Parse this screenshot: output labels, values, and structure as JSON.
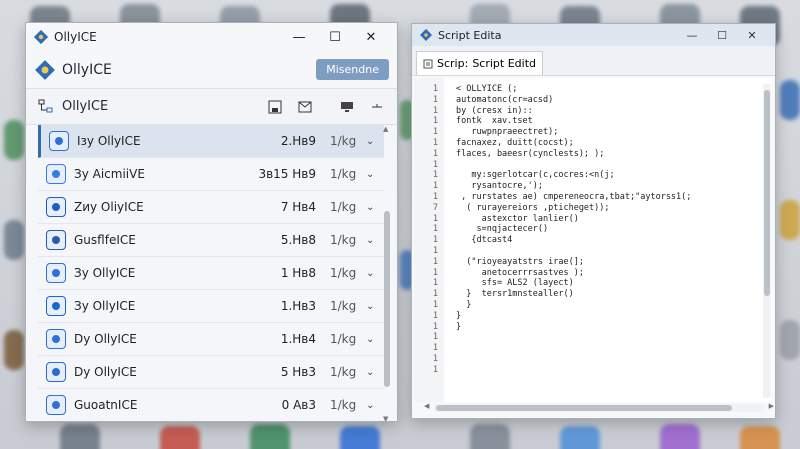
{
  "olly_window": {
    "title": "OllyICE",
    "controls": {
      "minimize": "—",
      "maximize": "☐",
      "close": "✕"
    },
    "app_name": "OllyICE",
    "primary_button": "Misendne",
    "toolbar_label": "OllyICE",
    "rows": [
      {
        "name": "Ізу OllyICE",
        "size": "2.Hв9",
        "rate": "1/kg",
        "icon_color": "#2f6fd6",
        "selected": true
      },
      {
        "name": "Зу AicmiiVE",
        "size": "3в15 Hв9",
        "rate": "1/kg",
        "icon_color": "#3a7be0",
        "selected": false
      },
      {
        "name": "Zиу OlіyICE",
        "size": "7 Hв4",
        "rate": "1/kg",
        "icon_color": "#1f5fbf",
        "selected": false
      },
      {
        "name": "GusflfeICE",
        "size": "5.Hв8",
        "rate": "1/kg",
        "icon_color": "#2a5aa8",
        "selected": false
      },
      {
        "name": "Зу OllyICE",
        "size": "1 Hв8",
        "rate": "1/kg",
        "icon_color": "#2f6fd6",
        "selected": false
      },
      {
        "name": "Зу OllyICE",
        "size": "1.Hв3",
        "rate": "1/kg",
        "icon_color": "#1d67c4",
        "selected": false
      },
      {
        "name": "Dy OllyICE",
        "size": "1.Hв4",
        "rate": "1/kg",
        "icon_color": "#2f6fd6",
        "selected": false
      },
      {
        "name": "Dy OllyICE",
        "size": "5 Hв3",
        "rate": "1/kg",
        "icon_color": "#2a6ad0",
        "selected": false
      },
      {
        "name": "GuoatnICE",
        "size": "0 Aв3",
        "rate": "1/kg",
        "icon_color": "#2f6fd6",
        "selected": false
      }
    ]
  },
  "editor_window": {
    "title": "Script Edita",
    "controls": {
      "minimize": "—",
      "maximize": "☐",
      "close": "✕"
    },
    "tab_prefix": "Scrip:",
    "tab_label": "Script Editd",
    "line_numbers": [
      "1",
      "1",
      "1",
      "1",
      "1",
      "1",
      "1",
      "1",
      "1",
      "1",
      "1",
      "7",
      "1",
      "1",
      "1",
      "1",
      "1",
      "1",
      "1",
      "1",
      "1",
      "1",
      "1",
      "1",
      "1",
      "1",
      "1"
    ],
    "code_lines": [
      "< OLLYICE (;",
      "automatonc(cr=acsd)",
      "by (cresx in)::",
      "fontk  xav.tset",
      "   ruwpnpraeectret);",
      "facnaxez, duitt(cocst);",
      "flaces, baeesr(cynclests); );",
      "",
      "   my:sgerlotcar(c,cocres:<n(j;",
      "   rysantocre,');",
      " , rurstates ae) cmpereneocra,tbat;\"aytorss1(;",
      "  ( rurayereiors ,pticheget));",
      "     astexctor lanlier()",
      "    s=nqjactecer()",
      "   {dtcast4",
      "",
      "  (\"rioyeayatstrs irae(];",
      "     anetocerrrsastves );",
      "     sfs= ALS2 (layect)",
      "  }  tersr1mnstealler()",
      "  }",
      "}",
      "}"
    ]
  }
}
